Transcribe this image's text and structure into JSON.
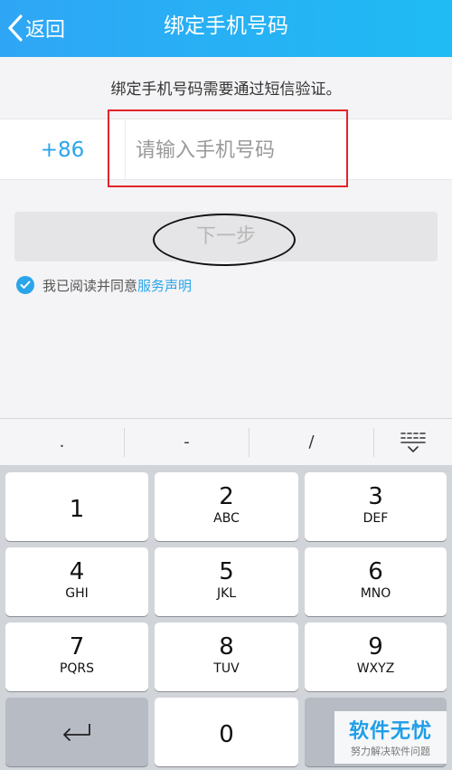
{
  "header": {
    "back_label": "返回",
    "title": "绑定手机号码"
  },
  "hint": "绑定手机号码需要通过短信验证。",
  "phone": {
    "country_code": "+86",
    "placeholder": "请输入手机号码",
    "value": ""
  },
  "next_button": {
    "label": "下一步",
    "enabled": false
  },
  "agreement": {
    "checked": true,
    "text": "我已阅读并同意",
    "link": "服务声明"
  },
  "toolbar": {
    "keys": [
      ".",
      "-",
      "/"
    ],
    "collapse_icon": "keyboard-collapse-icon"
  },
  "keypad": {
    "keys": [
      {
        "digit": "1",
        "letters": ""
      },
      {
        "digit": "2",
        "letters": "ABC"
      },
      {
        "digit": "3",
        "letters": "DEF"
      },
      {
        "digit": "4",
        "letters": "GHI"
      },
      {
        "digit": "5",
        "letters": "JKL"
      },
      {
        "digit": "6",
        "letters": "MNO"
      },
      {
        "digit": "7",
        "letters": "PQRS"
      },
      {
        "digit": "8",
        "letters": "TUV"
      },
      {
        "digit": "9",
        "letters": "WXYZ"
      },
      {
        "digit": "0",
        "letters": ""
      }
    ],
    "enter_icon": "return-icon"
  },
  "watermark": {
    "title": "软件无忧",
    "subtitle": "努力解决软件问题"
  },
  "colors": {
    "accent": "#2aa5ea",
    "header": "#1fb0f4",
    "annotation_box": "#e0252b"
  }
}
